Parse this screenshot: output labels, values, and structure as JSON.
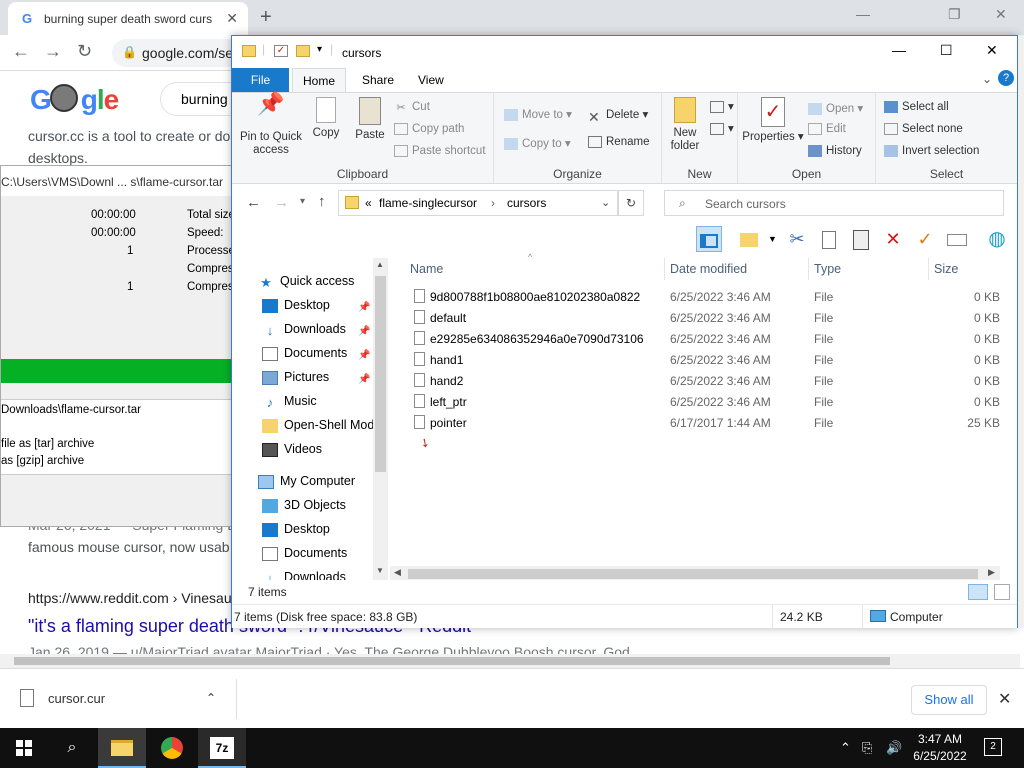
{
  "browser": {
    "tab_title": "burning super death sword curs",
    "url": "google.com/se",
    "new_tab_symbol": "+",
    "window_minimize": "—",
    "window_restore": "❐",
    "window_close": "✕"
  },
  "google": {
    "search_query": "burning",
    "snippet1": "cursor.cc is a tool to create or do",
    "snippet1b": "desktops.",
    "snippet2": "famous mouse cursor, now usab",
    "date_line": "Mar 26, 2021 — Super Flaming D",
    "reddit_breadcrumb": "https://www.reddit.com › Vinesau",
    "reddit_title": "\"it's a flaming super death sword\" : r/Vinesauce - Reddit",
    "reddit_meta": "Jan 26, 2019 — u/MajorTriad avatar MajorTriad · Yes. The George Dubblevoo Boosh cursor. God"
  },
  "zip_dialog": {
    "title": "C:\\Users\\VMS\\Downl ... s\\flame-cursor.tar",
    "elapsed": "00:00:00",
    "remaining": "00:00:00",
    "files": "1",
    "errors": "1",
    "label_total": "Total size",
    "label_speed": "Speed:",
    "label_processed": "Processe",
    "label_compressed1": "Compress",
    "label_compressed2": "Compress",
    "line1": "Downloads\\flame-cursor.tar",
    "line2": "file as [tar] archive",
    "line3": "as [gzip] archive"
  },
  "explorer": {
    "title": "cursors",
    "tabs": [
      "File",
      "Home",
      "Share",
      "View"
    ],
    "ribbon": {
      "clipboard": {
        "label": "Clipboard",
        "pin": "Pin to Quick access",
        "copy": "Copy",
        "paste": "Paste",
        "cut": "Cut",
        "copy_path": "Copy path",
        "paste_shortcut": "Paste shortcut"
      },
      "organize": {
        "label": "Organize",
        "move_to": "Move to",
        "copy_to": "Copy to",
        "delete": "Delete",
        "rename": "Rename"
      },
      "new": {
        "label": "New",
        "new_folder": "New folder"
      },
      "open": {
        "label": "Open",
        "properties": "Properties",
        "open": "Open",
        "edit": "Edit",
        "history": "History"
      },
      "select": {
        "label": "Select",
        "select_all": "Select all",
        "select_none": "Select none",
        "invert": "Invert selection"
      }
    },
    "breadcrumb": [
      "«",
      "flame-singlecursor",
      "›",
      "cursors"
    ],
    "search_placeholder": "Search cursors",
    "nav": [
      {
        "label": "Quick access",
        "pinned": false
      },
      {
        "label": "Desktop",
        "pinned": true
      },
      {
        "label": "Downloads",
        "pinned": true
      },
      {
        "label": "Documents",
        "pinned": true
      },
      {
        "label": "Pictures",
        "pinned": true
      },
      {
        "label": "Music",
        "pinned": false
      },
      {
        "label": "Open-Shell Mod",
        "pinned": false
      },
      {
        "label": "Videos",
        "pinned": false
      },
      {
        "label": "My Computer",
        "pinned": false
      },
      {
        "label": "3D Objects",
        "pinned": false
      },
      {
        "label": "Desktop",
        "pinned": false
      },
      {
        "label": "Documents",
        "pinned": false
      },
      {
        "label": "Downloads",
        "pinned": false
      }
    ],
    "columns": [
      "Name",
      "Date modified",
      "Type",
      "Size"
    ],
    "files": [
      {
        "name": "9d800788f1b08800ae810202380a0822",
        "date": "6/25/2022 3:46 AM",
        "type": "File",
        "size": "0 KB"
      },
      {
        "name": "default",
        "date": "6/25/2022 3:46 AM",
        "type": "File",
        "size": "0 KB"
      },
      {
        "name": "e29285e634086352946a0e7090d73106",
        "date": "6/25/2022 3:46 AM",
        "type": "File",
        "size": "0 KB"
      },
      {
        "name": "hand1",
        "date": "6/25/2022 3:46 AM",
        "type": "File",
        "size": "0 KB"
      },
      {
        "name": "hand2",
        "date": "6/25/2022 3:46 AM",
        "type": "File",
        "size": "0 KB"
      },
      {
        "name": "left_ptr",
        "date": "6/25/2022 3:46 AM",
        "type": "File",
        "size": "0 KB"
      },
      {
        "name": "pointer",
        "date": "6/17/2017 1:44 AM",
        "type": "File",
        "size": "25 KB"
      }
    ],
    "status_items": "7 items (Disk free space: 83.8 GB)",
    "status_size": "24.2 KB",
    "status_location": "Computer"
  },
  "download_bar": {
    "file_name": "cursor.cur",
    "show_all": "Show all"
  },
  "taskbar": {
    "time": "3:47 AM",
    "date": "6/25/2022",
    "notifications": "2",
    "seven_zip_label": "7z"
  },
  "colors": {
    "accent": "#1979ca",
    "progress_green": "#06b025",
    "delete_red": "#d11919",
    "check_orange": "#e8770e"
  }
}
